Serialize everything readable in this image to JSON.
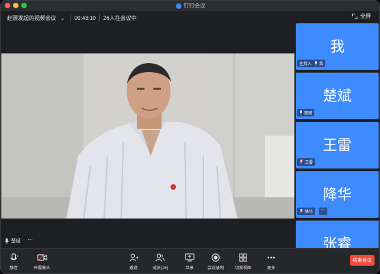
{
  "app": {
    "title": "钉钉会议"
  },
  "meeting": {
    "title": "赵源发起的视频会议",
    "elapsed": "00:43:10",
    "attendance": "26人在会议中",
    "fullscreen_label": "全屏"
  },
  "main_video": {
    "speaker_name": "楚斌"
  },
  "participants": [
    {
      "display": "我",
      "tag": "我",
      "host_label": "主持人"
    },
    {
      "display": "楚斌",
      "tag": "楚斌"
    },
    {
      "display": "王雷",
      "tag": "王雷"
    },
    {
      "display": "降华",
      "tag": "降华"
    },
    {
      "display": "张睿",
      "tag": ""
    }
  ],
  "toolbar": {
    "mute": "静音",
    "camera": "开摄像头",
    "invite": "邀请",
    "members": "成员(26)",
    "share": "共享",
    "record": "会议录制",
    "switch_view": "切换视图",
    "more": "更多",
    "end": "结束会议"
  },
  "colors": {
    "tile_blue": "#3e8bff",
    "end_red": "#ef4a3a",
    "background": "#1e1f22"
  }
}
